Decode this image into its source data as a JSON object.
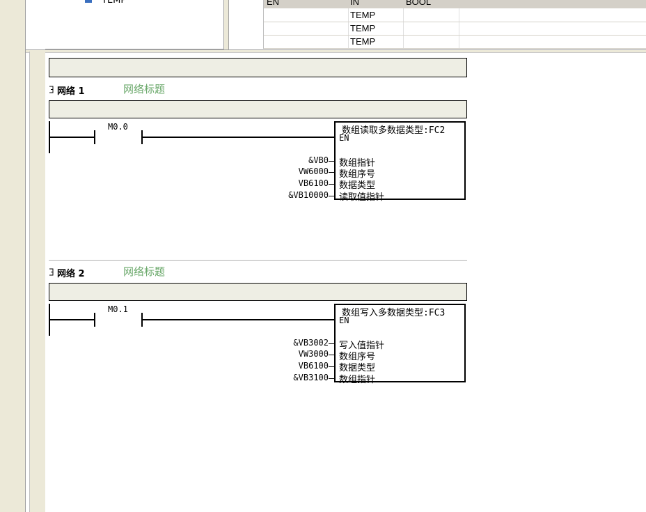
{
  "tree": {
    "item_label": "TEMP"
  },
  "var_table": {
    "header": [
      "EN",
      "IN",
      "BOOL"
    ],
    "rows": [
      {
        "type": "TEMP"
      },
      {
        "type": "TEMP"
      },
      {
        "type": "TEMP"
      }
    ]
  },
  "networks": [
    {
      "title": "网络 1",
      "comment": "网络标题",
      "contact_label": "M0.0",
      "block_title": "数组读取多数据类型:FC2",
      "en_label": "EN",
      "pins": [
        {
          "value": "&VB0",
          "label": "数组指针"
        },
        {
          "value": "VW6000",
          "label": "数组序号"
        },
        {
          "value": "VB6100",
          "label": "数据类型"
        },
        {
          "value": "&VB10000",
          "label": "读取值指针"
        }
      ]
    },
    {
      "title": "网络 2",
      "comment": "网络标题",
      "contact_label": "M0.1",
      "block_title": "数组写入多数据类型:FC3",
      "en_label": "EN",
      "pins": [
        {
          "value": "&VB3002",
          "label": "写入值指针"
        },
        {
          "value": "VW3000",
          "label": "数组序号"
        },
        {
          "value": "VB6100",
          "label": "数据类型"
        },
        {
          "value": "&VB3100",
          "label": "数组指针"
        }
      ]
    }
  ],
  "colors": {
    "comment_text": "#6aa86a",
    "comment_bg": "#eeeee4",
    "chrome": "#ece9d8"
  }
}
